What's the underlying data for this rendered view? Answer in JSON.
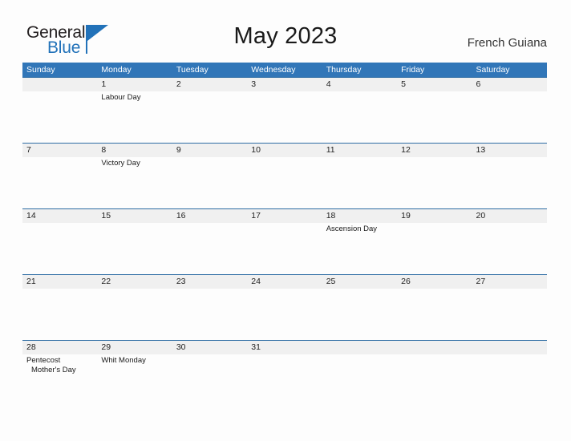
{
  "brand": {
    "name_part1": "General",
    "name_part2": "Blue",
    "color_dark": "#231f20",
    "color_blue": "#2272b9",
    "flag_icon": "flag-triangle-icon"
  },
  "header": {
    "title": "May 2023",
    "location": "French Guiana"
  },
  "theme": {
    "header_bar": "#3176b8",
    "week_rule": "#2e6da4",
    "date_band": "#f0f0f0",
    "page_bg": "#fdfdfd"
  },
  "calendar": {
    "weekday_headers": [
      "Sunday",
      "Monday",
      "Tuesday",
      "Wednesday",
      "Thursday",
      "Friday",
      "Saturday"
    ],
    "weeks": [
      {
        "days": [
          {
            "date": "",
            "events": []
          },
          {
            "date": "1",
            "events": [
              {
                "label": "Labour Day",
                "indented": false
              }
            ]
          },
          {
            "date": "2",
            "events": []
          },
          {
            "date": "3",
            "events": []
          },
          {
            "date": "4",
            "events": []
          },
          {
            "date": "5",
            "events": []
          },
          {
            "date": "6",
            "events": []
          }
        ]
      },
      {
        "days": [
          {
            "date": "7",
            "events": []
          },
          {
            "date": "8",
            "events": [
              {
                "label": "Victory Day",
                "indented": false
              }
            ]
          },
          {
            "date": "9",
            "events": []
          },
          {
            "date": "10",
            "events": []
          },
          {
            "date": "11",
            "events": []
          },
          {
            "date": "12",
            "events": []
          },
          {
            "date": "13",
            "events": []
          }
        ]
      },
      {
        "days": [
          {
            "date": "14",
            "events": []
          },
          {
            "date": "15",
            "events": []
          },
          {
            "date": "16",
            "events": []
          },
          {
            "date": "17",
            "events": []
          },
          {
            "date": "18",
            "events": [
              {
                "label": "Ascension Day",
                "indented": false
              }
            ]
          },
          {
            "date": "19",
            "events": []
          },
          {
            "date": "20",
            "events": []
          }
        ]
      },
      {
        "days": [
          {
            "date": "21",
            "events": []
          },
          {
            "date": "22",
            "events": []
          },
          {
            "date": "23",
            "events": []
          },
          {
            "date": "24",
            "events": []
          },
          {
            "date": "25",
            "events": []
          },
          {
            "date": "26",
            "events": []
          },
          {
            "date": "27",
            "events": []
          }
        ]
      },
      {
        "days": [
          {
            "date": "28",
            "events": [
              {
                "label": "Pentecost",
                "indented": false
              },
              {
                "label": "Mother's Day",
                "indented": true
              }
            ]
          },
          {
            "date": "29",
            "events": [
              {
                "label": "Whit Monday",
                "indented": false
              }
            ]
          },
          {
            "date": "30",
            "events": []
          },
          {
            "date": "31",
            "events": []
          },
          {
            "date": "",
            "events": []
          },
          {
            "date": "",
            "events": []
          },
          {
            "date": "",
            "events": []
          }
        ]
      }
    ]
  }
}
